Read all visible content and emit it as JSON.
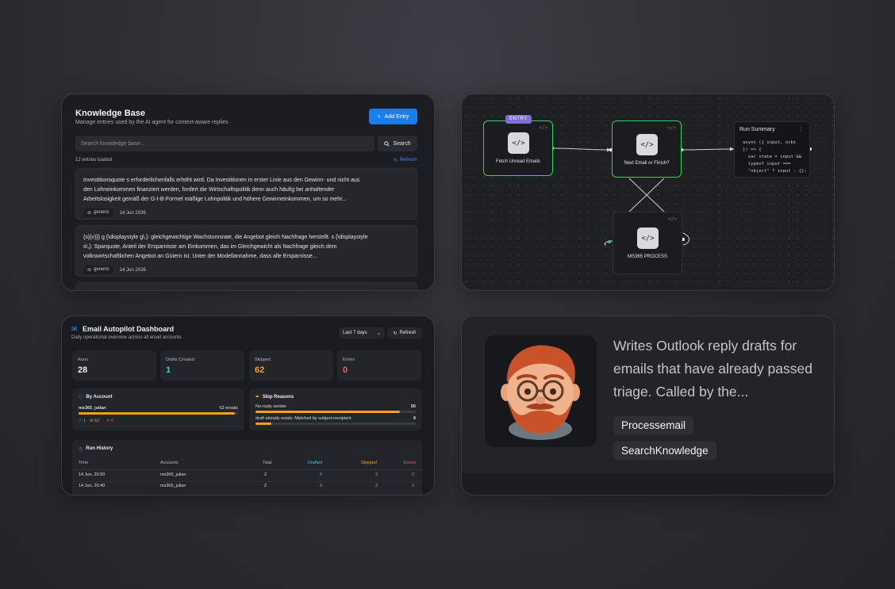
{
  "knowledge_base": {
    "title": "Knowledge Base",
    "subtitle": "Manage entries used by the AI agent for context-aware replies",
    "add_button": "Add Entry",
    "add_icon": "plus-icon",
    "search_placeholder": "Search knowledge base...",
    "search_button": "Search",
    "count_text": "12 entries loaded",
    "refresh": "Refresh",
    "entries": [
      {
        "text": "Investitionsquote s erforderlichenfalls erhöht wird. Da Investitionen in erster Linie aus den Gewinn- und nicht aus den Lohneinkommen finanziert werden, fordert die Wirtschaftspolitik denn auch häufig bei anhaltender Arbeitslosigkeit gemäß der G-I-B-Formel mäßige Lohnpolitik und höhere Gewinneinkommen, um so mehr...",
        "tag": "generic",
        "date": "14 Jun 2026"
      },
      {
        "text": "{s}{v}}} g {\\displaystyle g\\,}: gleichgewichtige Wachstumsrate, die Angebot gleich Nachfrage herstellt. s {\\displaystyle s\\,}: Sparquote, Anteil der Ersparnisse am Einkommen, das im Gleichgewicht als Nachfrage gleich dem volkswirtschaftlichen Angebot an Gütern ist. Unter der Modellannahme, dass alle Ersparnisse...",
        "tag": "generic",
        "date": "14 Jun 2026"
      }
    ]
  },
  "workflow": {
    "nodes": [
      {
        "label": "Fetch Unread Emails",
        "badge": "ENTRY",
        "icon": "code-icon"
      },
      {
        "label": "Next Email or Finish?",
        "icon": "code-icon"
      },
      {
        "label": "MS365 PROCESS",
        "icon": "code-icon"
      }
    ],
    "summary": {
      "title": "Run Summary",
      "code": "async ({ input, orbi\n}) => {\n  var state = input &&\n  typeof input ===\n  \"object\" ? input : {};"
    }
  },
  "dashboard": {
    "title": "Email Autopilot Dashboard",
    "subtitle": "Daily operational overview across all email accounts",
    "range": "Last 7 days",
    "refresh": "Refresh",
    "stats": [
      {
        "label": "Runs",
        "value": "28",
        "color": "#e8e8ec"
      },
      {
        "label": "Drafts Created",
        "value": "1",
        "color": "#3fc7d6"
      },
      {
        "label": "Skipped",
        "value": "62",
        "color": "#f0a21c"
      },
      {
        "label": "Errors",
        "value": "0",
        "color": "#ef5a6f"
      }
    ],
    "by_account": {
      "title": "By Account",
      "account": "ms365_julian",
      "emails": "63 emails",
      "fill": 0.98,
      "drafted": "✓ 1",
      "skipped": "⊘ 62",
      "errors": "✕ 0"
    },
    "skip_reasons": {
      "title": "Skip Reasons",
      "items": [
        {
          "label": "No-reply sender",
          "count": "56",
          "fill": 0.9
        },
        {
          "label": "draft already exists: Matched by subject+recipient",
          "count": "6",
          "fill": 0.1
        }
      ]
    },
    "run_history": {
      "title": "Run History",
      "headers": [
        "Time",
        "Accounts",
        "Total",
        "Drafted",
        "Skipped",
        "Errors"
      ],
      "rows": [
        [
          "14 Jun, 20:50",
          "ms365_julian",
          "2",
          "0",
          "2",
          "0"
        ],
        [
          "14 Jun, 20:40",
          "ms365_julian",
          "2",
          "0",
          "2",
          "0"
        ]
      ]
    }
  },
  "agent": {
    "description": "Writes Outlook reply drafts for emails that have already passed triage. Called by the...",
    "tools": [
      "Processemail",
      "SearchKnowledge"
    ],
    "avatar": "bearded-man-avatar"
  }
}
